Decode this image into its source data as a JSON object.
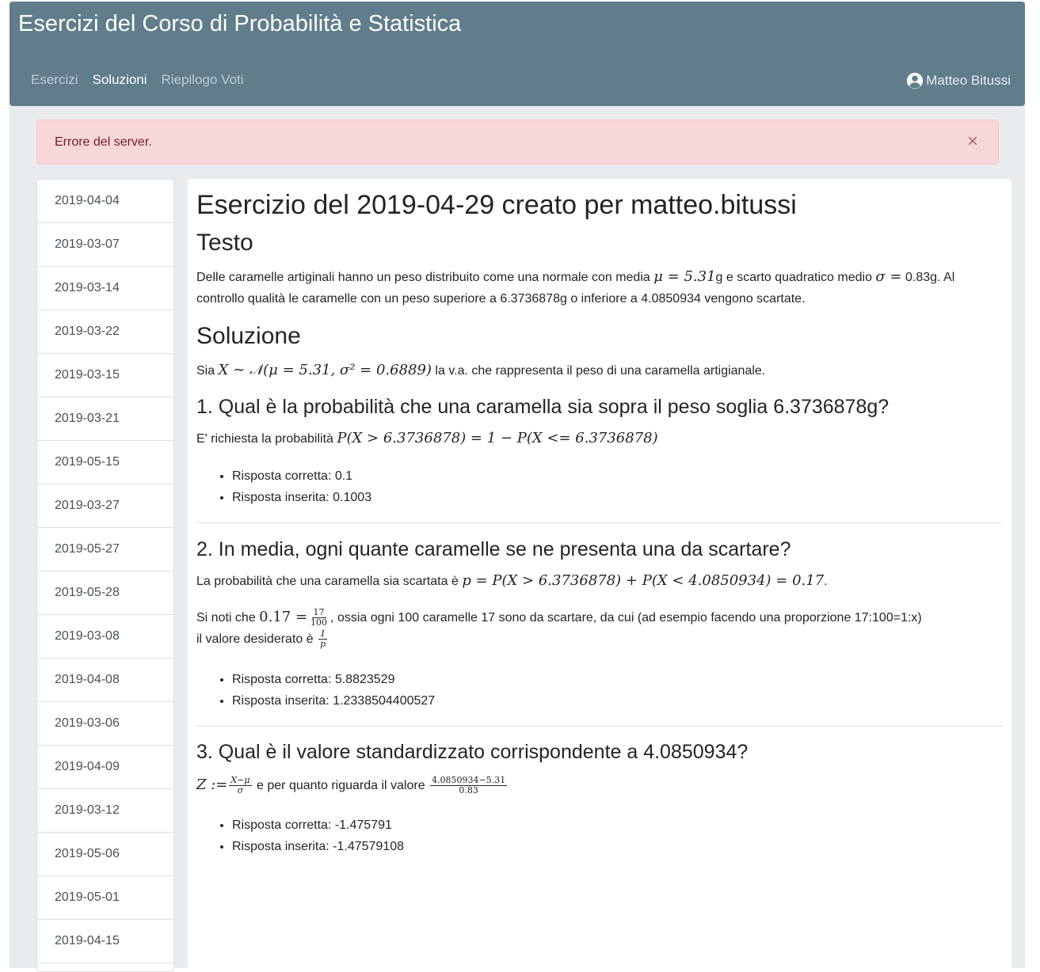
{
  "navbar": {
    "brand": "Esercizi del Corso di Probabilità e Statistica",
    "links": [
      "Esercizi",
      "Soluzioni",
      "Riepilogo Voti"
    ],
    "user": "Matteo Bitussi"
  },
  "alert": {
    "message": "Errore del server.",
    "close": "×"
  },
  "sidebar": {
    "dates": [
      "2019-04-04",
      "2019-03-07",
      "2019-03-14",
      "2019-03-22",
      "2019-03-15",
      "2019-03-21",
      "2019-05-15",
      "2019-03-27",
      "2019-05-27",
      "2019-05-28",
      "2019-03-08",
      "2019-04-08",
      "2019-03-06",
      "2019-04-09",
      "2019-03-12",
      "2019-05-06",
      "2019-05-01",
      "2019-04-15"
    ]
  },
  "content": {
    "title": "Esercizio del 2019-04-29 creato per matteo.bitussi",
    "testo_heading": "Testo",
    "testo_a": "Delle caramelle artiginali hanno un peso distribuito come una normale con media ",
    "testo_mu": "μ = 5.31",
    "testo_b": "g e scarto quadratico medio ",
    "testo_sigma": "σ =",
    "testo_c": "0.83g. Al controllo qualità le caramelle con un peso superiore a 6.3736878g o inferiore a 4.0850934 vengono scartate.",
    "soluzione_heading": "Soluzione",
    "sol_a": "Sia ",
    "sol_math": "X ∼ 𝒩(μ = 5.31, σ² = 0.6889)",
    "sol_b": " la v.a. che rappresenta il peso di una caramella artigianale.",
    "questions": [
      {
        "title": "1. Qual è la probabilità che una caramella sia sopra il peso soglia 6.3736878g?",
        "text_a": "E' richiesta la probabilità ",
        "math": "P(X > 6.3736878) = 1 − P(X <= 6.3736878)",
        "correct": "Risposta corretta: 0.1",
        "inserted": "Risposta inserita: 0.1003"
      },
      {
        "title": "2. In media, ogni quante caramelle se ne presenta una da scartare?",
        "text_a": "La probabilità che una caramella sia scartata è ",
        "math": "p = P(X > 6.3736878) + P(X < 4.0850934) = 0.17",
        "text_b": ".",
        "note_a": "Si noti che ",
        "note_math": "0.17 =",
        "frac_num": "17",
        "frac_den": "100",
        "note_b": ", ossia ogni 100 caramelle 17 sono da scartare, da cui (ad esempio facendo una proporzione 17:100=1:x)",
        "note_c": "il valore desiderato è ",
        "frac2_num": "1",
        "frac2_den": "p",
        "correct": "Risposta corretta: 5.8823529",
        "inserted": "Risposta inserita: 1.2338504400527"
      },
      {
        "title": "3. Qual è il valore standardizzato corrispondente a 4.0850934?",
        "math": "Z :=",
        "frac_num": "X−μ",
        "frac_den": "σ",
        "text_a": " e per quanto riguarda il valore ",
        "frac2_num": "4.0850934−5.31",
        "frac2_den": "0.83",
        "correct": "Risposta corretta: -1.475791",
        "inserted": "Risposta inserita: -1.47579108"
      }
    ]
  },
  "colors": {
    "navbar": "#607d8b",
    "alert_bg": "#f8d7da",
    "alert_text": "#721c24",
    "page_bg": "#e9ecef"
  }
}
